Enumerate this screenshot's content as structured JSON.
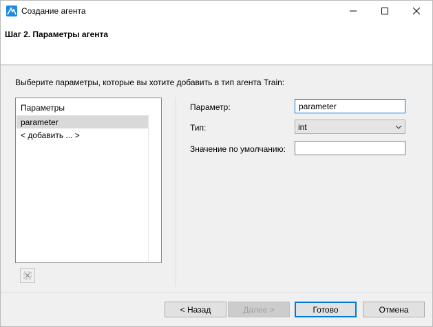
{
  "window": {
    "title": "Создание агента"
  },
  "header": {
    "title": "Шаг 2. Параметры агента"
  },
  "instruction": "Выберите параметры, которые вы хотите добавить в тип агента Train:",
  "param_list": {
    "header": "Параметры",
    "items": [
      "parameter"
    ],
    "add_item": "< добавить ... >"
  },
  "form": {
    "param_label": "Параметр:",
    "param_value": "parameter",
    "type_label": "Тип:",
    "type_value": "int",
    "default_label": "Значение по умолчанию:",
    "default_value": ""
  },
  "buttons": {
    "back": "< Назад",
    "next": "Далее >",
    "finish": "Готово",
    "cancel": "Отмена"
  },
  "colors": {
    "focus_border": "#0078d7",
    "selection": "#d9d9d9",
    "app_icon": "#1e88e5"
  }
}
